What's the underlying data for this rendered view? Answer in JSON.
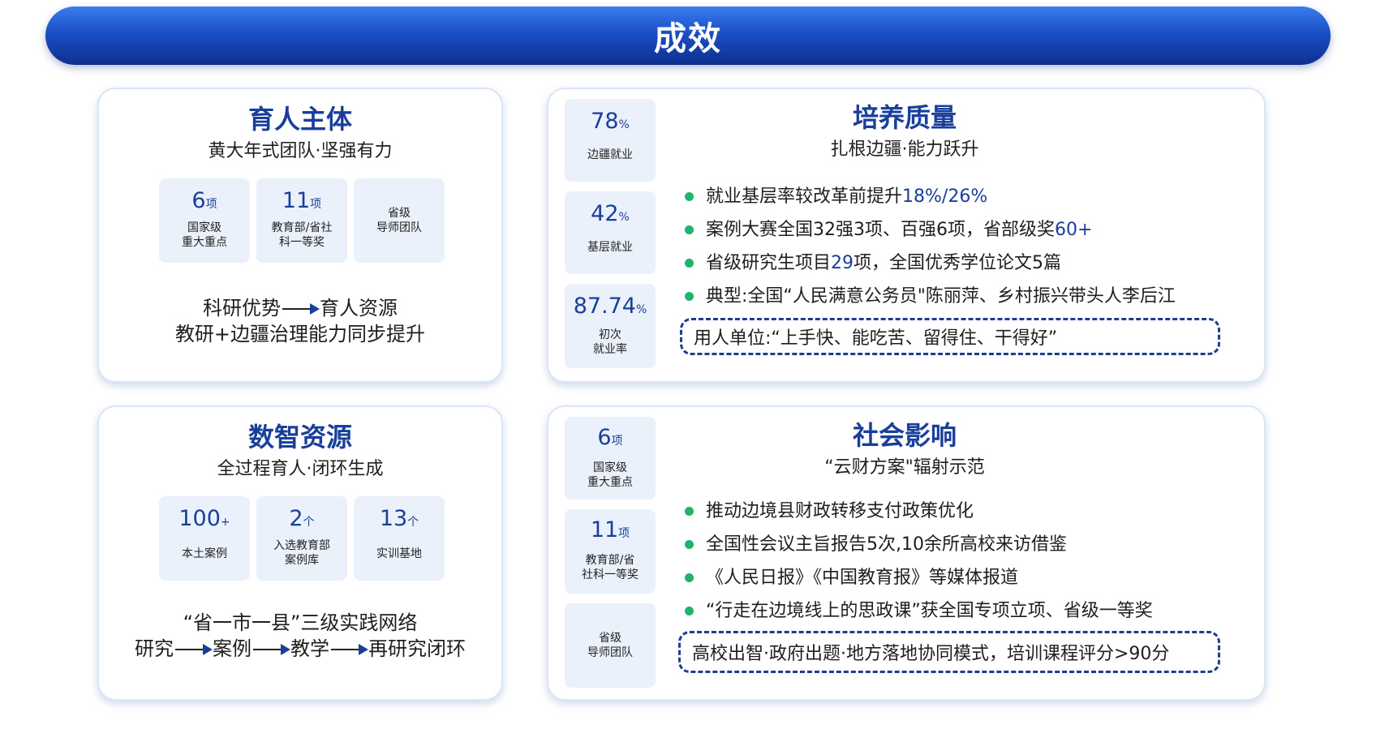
{
  "title": "成效",
  "card1": {
    "title": "育人主体",
    "subtitle": "黄大年式团队·坚强有力",
    "stats": [
      {
        "num": "6",
        "unit": "项",
        "l1": "国家级",
        "l2": "重大重点"
      },
      {
        "num": "11",
        "unit": "项",
        "l1": "教育部/省社",
        "l2": "科一等奖"
      },
      {
        "num": "",
        "unit": "",
        "l1": "省级",
        "l2": "导师团队"
      }
    ],
    "line1_a": "科研优势",
    "line1_b": "育人资源",
    "line2": "教研+边疆治理能力同步提升"
  },
  "card2": {
    "title": "培养质量",
    "subtitle": "扎根边疆·能力跃升",
    "side": [
      {
        "num": "78",
        "unit": "%",
        "l1": "边疆就业",
        "l2": ""
      },
      {
        "num": "42",
        "unit": "%",
        "l1": "基层就业",
        "l2": ""
      },
      {
        "num": "87.74",
        "unit": "%",
        "l1": "初次",
        "l2": "就业率"
      }
    ],
    "bullets": [
      {
        "text": "就业基层率较改革前提升",
        "hl": "18%/26%"
      },
      {
        "text": "案例大赛全国32强3项、百强6项，省部级奖",
        "hl": "60+"
      },
      {
        "text": "省级研究生项目",
        "hl": "29",
        "rest": "项，全国优秀学位论文5篇"
      },
      {
        "text": "典型:全国“人民满意公务员\"陈丽萍、乡村振兴带头人李后江",
        "hl": ""
      }
    ],
    "dash": "用人单位:“上手快、能吃苦、留得住、干得好”"
  },
  "card3": {
    "title": "数智资源",
    "subtitle": "全过程育人·闭环生成",
    "stats": [
      {
        "num": "100",
        "unit": "+",
        "l1": "本土案例",
        "l2": ""
      },
      {
        "num": "2",
        "unit": "个",
        "l1": "入选教育部",
        "l2": "案例库"
      },
      {
        "num": "13",
        "unit": "个",
        "l1": "实训基地",
        "l2": ""
      }
    ],
    "line1": "“省一市一县”三级实践网络",
    "flow": [
      "研究",
      "案例",
      "教学",
      "再研究闭环"
    ]
  },
  "card4": {
    "title": "社会影响",
    "subtitle": "“云财方案\"辐射示范",
    "side": [
      {
        "num": "6",
        "unit": "项",
        "l1": "国家级",
        "l2": "重大重点"
      },
      {
        "num": "11",
        "unit": "项",
        "l1": "教育部/省",
        "l2": "社科一等奖"
      },
      {
        "num": "",
        "unit": "",
        "l1": "省级",
        "l2": "导师团队"
      }
    ],
    "bullets": [
      {
        "text": "推动边境县财政转移支付政策优化"
      },
      {
        "text": "全国性会议主旨报告5次,10余所高校来访借鉴"
      },
      {
        "text": "《人民日报》《中国教育报》等媒体报道"
      },
      {
        "text": "“行走在边境线上的思政课”获全国专项立项、省级一等奖"
      }
    ],
    "dash": "高校出智·政府出题·地方落地协同模式，培训课程评分>90分"
  }
}
